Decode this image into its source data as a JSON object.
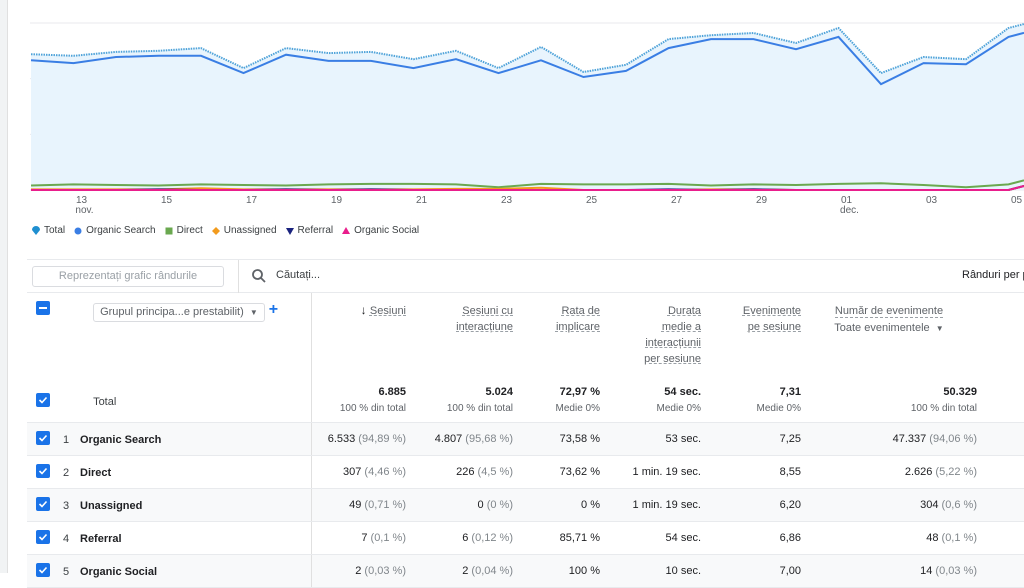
{
  "chart_data": {
    "type": "line",
    "x": [
      "12 nov.",
      "13 nov.",
      "14 nov.",
      "15 nov.",
      "16 nov.",
      "17 nov.",
      "18 nov.",
      "19 nov.",
      "20 nov.",
      "21 nov.",
      "22 nov.",
      "23 nov.",
      "24 nov.",
      "25 nov.",
      "26 nov.",
      "27 nov.",
      "28 nov.",
      "29 nov.",
      "30 nov.",
      "01 dec.",
      "02 dec.",
      "03 dec.",
      "04 dec.",
      "05 dec."
    ],
    "xtick_labels": [
      {
        "day": "13",
        "month": "nov.",
        "i": 1
      },
      {
        "day": "15",
        "i": 3
      },
      {
        "day": "17",
        "i": 5
      },
      {
        "day": "19",
        "i": 7
      },
      {
        "day": "21",
        "i": 9
      },
      {
        "day": "23",
        "i": 11
      },
      {
        "day": "25",
        "i": 13
      },
      {
        "day": "27",
        "i": 15
      },
      {
        "day": "29",
        "i": 17
      },
      {
        "day": "01",
        "month": "dec.",
        "i": 19
      },
      {
        "day": "03",
        "i": 21
      },
      {
        "day": "05",
        "i": 23
      }
    ],
    "ylim": [
      0,
      300
    ],
    "grid": true,
    "legend_placement": "bottom-left",
    "series": [
      {
        "name": "Total",
        "color": "#4fa3d9",
        "style": "dotted",
        "area": true,
        "values": [
          244,
          241,
          248,
          250,
          255,
          219,
          255,
          246,
          248,
          235,
          250,
          219,
          257,
          212,
          225,
          271,
          278,
          282,
          264,
          291,
          210,
          239,
          235,
          291
        ]
      },
      {
        "name": "Organic Search",
        "color": "#3a7ee4",
        "values": [
          233,
          228,
          239,
          241,
          241,
          210,
          243,
          232,
          232,
          219,
          235,
          210,
          233,
          203,
          214,
          255,
          271,
          271,
          253,
          275,
          190,
          228,
          226,
          275
        ]
      },
      {
        "name": "Direct",
        "color": "#6aa84f",
        "values": [
          8,
          10,
          9,
          8,
          10,
          9,
          8,
          10,
          11,
          11,
          10,
          5,
          11,
          10,
          10,
          11,
          8,
          10,
          9,
          11,
          12,
          9,
          5,
          10
        ]
      },
      {
        "name": "Unassigned",
        "color": "#f29b1d",
        "values": [
          1,
          1,
          1,
          1,
          3,
          1,
          1,
          1,
          1,
          1,
          2,
          2,
          4,
          0,
          0,
          0,
          1,
          1,
          0,
          0,
          0,
          0,
          0,
          0
        ]
      },
      {
        "name": "Referral",
        "color": "#1a237e",
        "values": [
          0,
          0,
          0,
          1,
          0,
          0,
          1,
          0,
          1,
          0,
          0,
          0,
          0,
          0,
          0,
          1,
          0,
          1,
          0,
          0,
          0,
          0,
          0,
          0
        ]
      },
      {
        "name": "Organic Social",
        "color": "#e91e8c",
        "values": [
          0,
          0,
          0,
          0,
          0,
          0,
          0,
          0,
          0,
          0,
          0,
          0,
          0,
          0,
          0,
          0,
          0,
          0,
          0,
          0,
          0,
          0,
          0,
          0
        ]
      }
    ]
  },
  "legend": [
    {
      "label": "Total",
      "icon": "teardrop",
      "color": "#1f8fd0"
    },
    {
      "label": "Organic Search",
      "icon": "circle",
      "color": "#3a7ee4"
    },
    {
      "label": "Direct",
      "icon": "square",
      "color": "#6aa84f"
    },
    {
      "label": "Unassigned",
      "icon": "diamond",
      "color": "#f29b1d"
    },
    {
      "label": "Referral",
      "icon": "triangle-down",
      "color": "#1a237e"
    },
    {
      "label": "Organic Social",
      "icon": "triangle-up",
      "color": "#e91e8c"
    }
  ],
  "toolbar": {
    "plot_rows": "Reprezentați grafic rândurile",
    "search_placeholder": "Căutați...",
    "rows_per_page": "Rânduri per p"
  },
  "table": {
    "dimension_select": "Grupul principa...e prestabilit)",
    "columns": [
      {
        "label": "Sesiuni",
        "sorted": "desc"
      },
      {
        "label": "Sesiuni cu interacțiune"
      },
      {
        "label": "Rata de implicare"
      },
      {
        "label": "Durata medie a interacțiunii per sesiune"
      },
      {
        "label": "Evenimente pe sesiune"
      },
      {
        "label": "Număr de evenimente",
        "sub_select": "Toate evenimentele"
      }
    ],
    "total": {
      "label": "Total",
      "values": [
        {
          "v": "6.885",
          "s": "100 % din total"
        },
        {
          "v": "5.024",
          "s": "100 % din total"
        },
        {
          "v": "72,97 %",
          "s": "Medie 0%"
        },
        {
          "v": "54 sec.",
          "s": "Medie 0%"
        },
        {
          "v": "7,31",
          "s": "Medie 0%"
        },
        {
          "v": "50.329",
          "s": "100 % din total"
        }
      ]
    },
    "rows": [
      {
        "n": "1",
        "name": "Organic Search",
        "c": [
          [
            "6.533",
            "(94,89 %)"
          ],
          [
            "4.807",
            "(95,68 %)"
          ],
          [
            "73,58 %",
            ""
          ],
          [
            "53 sec.",
            ""
          ],
          [
            "7,25",
            ""
          ],
          [
            "47.337",
            "(94,06 %)"
          ]
        ]
      },
      {
        "n": "2",
        "name": "Direct",
        "c": [
          [
            "307",
            "(4,46 %)"
          ],
          [
            "226",
            "(4,5 %)"
          ],
          [
            "73,62 %",
            ""
          ],
          [
            "1 min. 19 sec.",
            ""
          ],
          [
            "8,55",
            ""
          ],
          [
            "2.626",
            "(5,22 %)"
          ]
        ]
      },
      {
        "n": "3",
        "name": "Unassigned",
        "c": [
          [
            "49",
            "(0,71 %)"
          ],
          [
            "0",
            "(0 %)"
          ],
          [
            "0 %",
            ""
          ],
          [
            "1 min. 19 sec.",
            ""
          ],
          [
            "6,20",
            ""
          ],
          [
            "304",
            "(0,6 %)"
          ]
        ]
      },
      {
        "n": "4",
        "name": "Referral",
        "c": [
          [
            "7",
            "(0,1 %)"
          ],
          [
            "6",
            "(0,12 %)"
          ],
          [
            "85,71 %",
            ""
          ],
          [
            "54 sec.",
            ""
          ],
          [
            "6,86",
            ""
          ],
          [
            "48",
            "(0,1 %)"
          ]
        ]
      },
      {
        "n": "5",
        "name": "Organic Social",
        "c": [
          [
            "2",
            "(0,03 %)"
          ],
          [
            "2",
            "(0,04 %)"
          ],
          [
            "100 %",
            ""
          ],
          [
            "10 sec.",
            ""
          ],
          [
            "7,00",
            ""
          ],
          [
            "14",
            "(0,03 %)"
          ]
        ]
      }
    ]
  },
  "colors": {
    "accent": "#1a73e8"
  }
}
